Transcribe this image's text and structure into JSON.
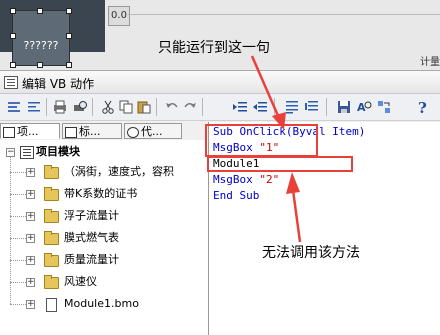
{
  "canvas": {
    "widget_label": "??????",
    "value_box": "0.0",
    "cut_label": "计量"
  },
  "window": {
    "title": "编辑 VB 动作"
  },
  "toolbar": {
    "buttons": [
      "list-icon",
      "outdent-icon",
      "print-icon",
      "preview-icon",
      "cut-icon",
      "copy-icon",
      "paste-icon",
      "undo-icon",
      "redo-icon",
      "indent-icon",
      "unindent-icon",
      "comment-icon",
      "uncomment-icon",
      "save-icon",
      "find-icon",
      "replace-icon",
      "help-icon"
    ]
  },
  "left_panel": {
    "tabs": [
      {
        "label": "项..."
      },
      {
        "label": "标..."
      },
      {
        "label": "代..."
      }
    ],
    "tree": {
      "root": "项目模块",
      "items": [
        {
          "label": "（涡街，速度式，容积"
        },
        {
          "label": "带K系数的证书"
        },
        {
          "label": "浮子流量计"
        },
        {
          "label": "膜式燃气表"
        },
        {
          "label": "质量流量计"
        },
        {
          "label": "风速仪"
        },
        {
          "label": "Module1.bmo"
        }
      ]
    }
  },
  "editor": {
    "lines": [
      {
        "kw": "Sub ",
        "rest": "OnClick(Byval Item)"
      },
      {
        "kw": "MsgBox ",
        "str": "\"1\""
      },
      {
        "plain": "Module1"
      },
      {
        "kw": "MsgBox ",
        "str": "\"2\""
      },
      {
        "kw": "End Sub",
        "rest": ""
      }
    ]
  },
  "annotations": {
    "top": "只能运行到这一句",
    "bottom": "无法调用该方法"
  },
  "colors": {
    "annotation_red": "#e8413a",
    "keyword_blue": "#0000cc",
    "string_red": "#cc0000"
  }
}
